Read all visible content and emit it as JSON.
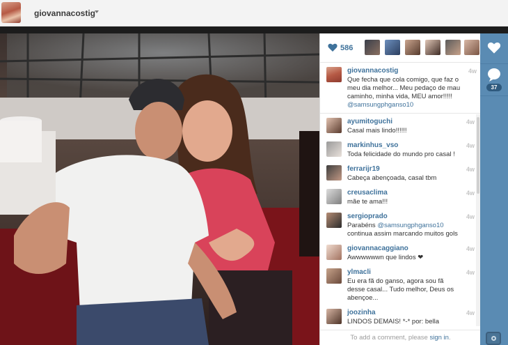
{
  "header": {
    "username": "giovannacostig"
  },
  "post": {
    "likes": "586",
    "caption": {
      "username": "giovannacostig",
      "text": "Que fecha que cola comigo, que faz o meu dia melhor... Meu pedaço de mau caminho, minha vida, MEU amor!!!!!",
      "mention": "@samsungphganso10",
      "time": "4w"
    },
    "comments": [
      {
        "username": "ayumitoguchi",
        "text": "Casal mais lindo!!!!!!",
        "time": "4w"
      },
      {
        "username": "markinhus_vso",
        "text": "Toda felicidade do mundo pro casal !",
        "time": "4w"
      },
      {
        "username": "ferrarijr19",
        "text": "Cabeça abençoada, casal tbm",
        "time": "4w"
      },
      {
        "username": "creusaclima",
        "text": "mãe te ama!!!",
        "time": "4w"
      },
      {
        "username": "sergioprado",
        "text_prefix": "Parabéns ",
        "mention": "@samsungphganso10",
        "text_suffix": "continua assim marcando muitos gols",
        "time": "4w"
      },
      {
        "username": "giovannacaggiano",
        "text": "Awwwwwwn que lindos ❤",
        "time": "4w"
      },
      {
        "username": "ylmacli",
        "text": "Eu era fã do ganso, agora sou fã desse casal... Tudo melhor, Deus os abençoe...",
        "time": "4w"
      },
      {
        "username": "joozinha",
        "text": "LINDOS DEMAIS! *-* por: bella",
        "time": "4w"
      }
    ],
    "add_comment_prefix": "To add a comment, please",
    "add_comment_link": "sign in",
    "add_comment_suffix": "."
  },
  "sidebar": {
    "comment_count": "37"
  },
  "icons": [
    "heart-icon",
    "comment-icon",
    "instagram-logo-icon",
    "chevron-down-icon"
  ],
  "colors": {
    "link": "#3f729b",
    "sidebar": "#5a8bb3",
    "time": "#c5c5c5"
  }
}
